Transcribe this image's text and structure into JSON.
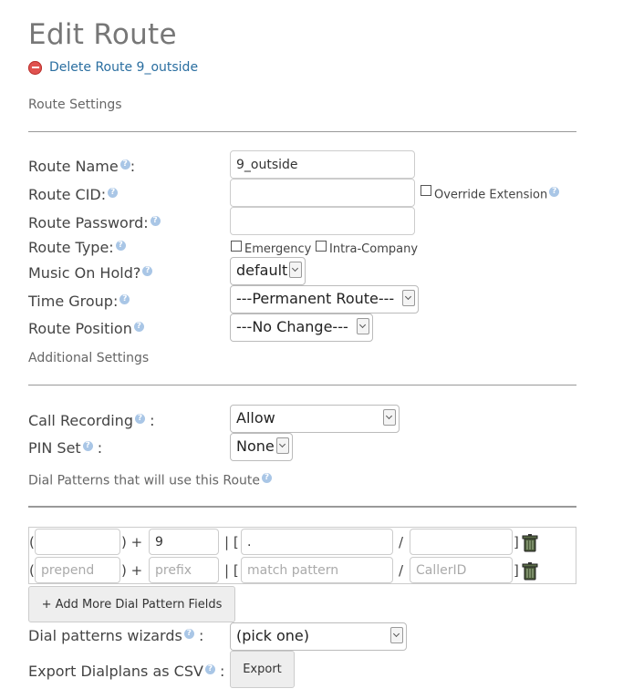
{
  "page": {
    "title": "Edit Route",
    "delete_link": "Delete Route 9_outside"
  },
  "route_settings": {
    "section_title": "Route Settings",
    "route_name": {
      "label": "Route Name",
      "suffix": ":",
      "value": "9_outside"
    },
    "route_cid": {
      "label": "Route CID:",
      "value": "",
      "override_label": "Override Extension"
    },
    "route_password": {
      "label": "Route Password:",
      "value": ""
    },
    "route_type": {
      "label": "Route Type:",
      "emergency_label": "Emergency",
      "intra_company_label": "Intra-Company"
    },
    "music_on_hold": {
      "label": "Music On Hold?",
      "value": "default"
    },
    "time_group": {
      "label": "Time Group:",
      "value": "---Permanent Route---"
    },
    "route_position": {
      "label": "Route Position",
      "value": "---No Change---"
    }
  },
  "additional_settings": {
    "section_title": "Additional Settings",
    "call_recording": {
      "label": "Call Recording",
      "suffix": ":",
      "value": "Allow"
    },
    "pin_set": {
      "label": "PIN Set",
      "suffix": ":",
      "value": "None"
    }
  },
  "dial_patterns": {
    "section_title": "Dial Patterns that will use this Route",
    "rows": [
      {
        "prepend": "",
        "prefix": "9",
        "match_pattern": ".",
        "caller_id": ""
      },
      {
        "prepend": "",
        "prefix": "",
        "match_pattern": "",
        "caller_id": ""
      }
    ],
    "placeholders": {
      "prepend": "prepend",
      "prefix": "prefix",
      "match_pattern": "match pattern",
      "caller_id": "CallerID"
    },
    "symbols": {
      "open_paren": "(",
      "close_plus": ") +",
      "bar_bracket": "| [",
      "slash": "/",
      "close_bracket": "]"
    },
    "add_more_label": "+ Add More Dial Pattern Fields",
    "wizards": {
      "label": "Dial patterns wizards",
      "suffix": ":",
      "value": "(pick one)"
    },
    "export": {
      "label": "Export Dialplans as CSV",
      "suffix": ":",
      "button_label": "Export"
    }
  },
  "icons": {
    "help": "help-question-icon",
    "delete": "minus-circle-icon",
    "trash": "trash-can-icon"
  },
  "colors": {
    "link": "#2a6ea0",
    "delete_red": "#e0524f",
    "help_blue": "#a9c6e6"
  }
}
